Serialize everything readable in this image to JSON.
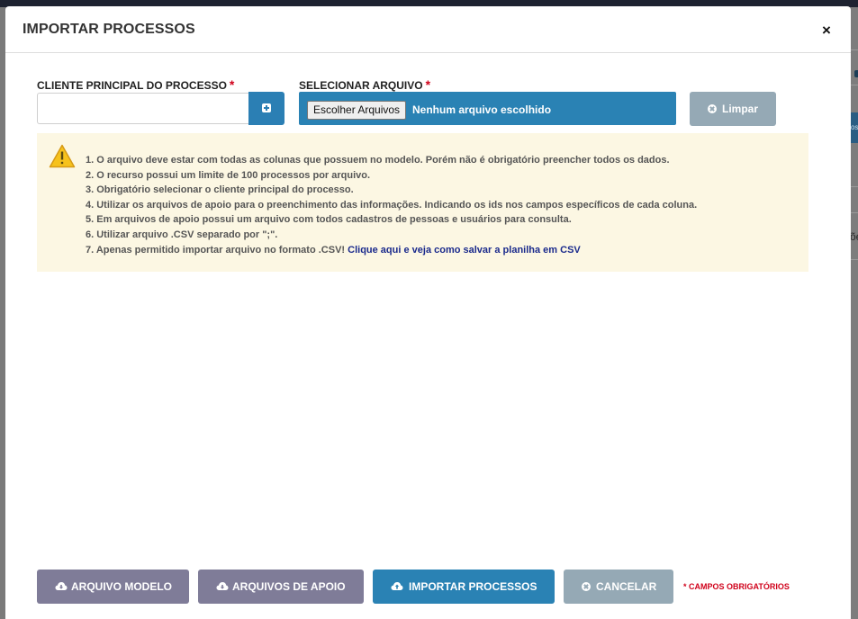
{
  "modal": {
    "title": "IMPORTAR PROCESSOS",
    "close_label": "×"
  },
  "form": {
    "client_label": "CLIENTE PRINCIPAL DO PROCESSO",
    "client_value": "",
    "file_label": "SELECIONAR ARQUIVO",
    "required_mark": "*",
    "file_button_label": "Escolher Arquivos",
    "file_status": "Nenhum arquivo escolhido",
    "clear_label": "Limpar"
  },
  "instructions": {
    "items": [
      "1. O arquivo deve estar com todas as colunas que possuem no modelo. Porém não é obrigatório preencher todos os dados.",
      "2. O recurso possui um limite de 100 processos por arquivo.",
      "3. Obrigatório selecionar o cliente principal do processo.",
      "4. Utilizar os arquivos de apoio para o preenchimento das informações. Indicando os ids nos campos específicos de cada coluna.",
      "5. Em arquivos de apoio possui um arquivo com todos cadastros de pessoas e usuários para consulta.",
      "6. Utilizar arquivo .CSV separado por \";\".",
      "7. Apenas permitido importar arquivo no formato .CSV!"
    ],
    "link_text": "Clique aqui e veja como salvar a planilha em CSV"
  },
  "footer": {
    "model_label": "ARQUIVO MODELO",
    "support_label": "ARQUIVOS DE APOIO",
    "import_label": "IMPORTAR PROCESSOS",
    "cancel_label": "CANCELAR",
    "required_note": "* CAMPOS OBRIGATÓRIOS"
  },
  "background": {
    "partial_text": "õe"
  },
  "colors": {
    "primary": "#2a82b4",
    "muted_button": "#95a9b5",
    "purple_button": "#7f7c98",
    "required": "#d0021b",
    "alert_bg": "#fcf7e3",
    "link": "#1a2a8c"
  }
}
